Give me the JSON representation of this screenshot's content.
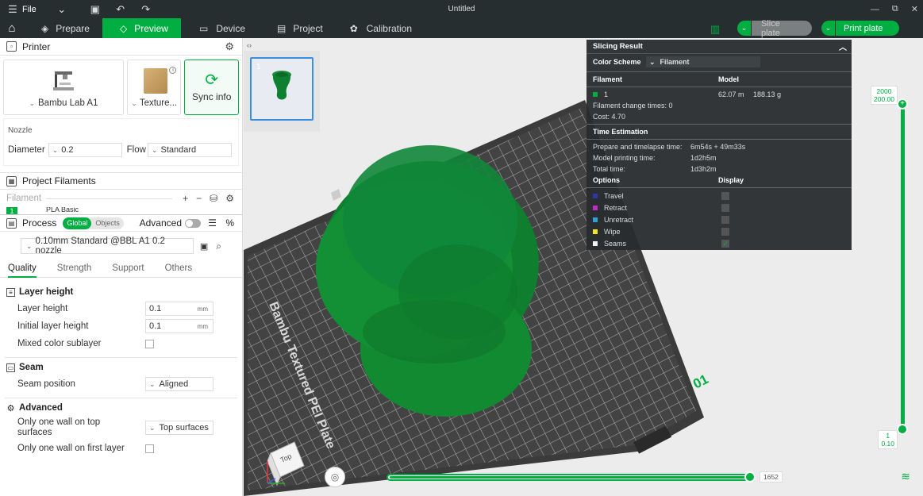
{
  "titlebar": {
    "file_label": "File",
    "title": "Untitled"
  },
  "tabs": [
    {
      "label": "Prepare",
      "icon": "cube-icon"
    },
    {
      "label": "Preview",
      "icon": "layers-icon",
      "active": true
    },
    {
      "label": "Device",
      "icon": "device-icon"
    },
    {
      "label": "Project",
      "icon": "project-icon"
    },
    {
      "label": "Calibration",
      "icon": "calibration-icon"
    }
  ],
  "actions": {
    "slice_label": "Slice plate",
    "print_label": "Print plate"
  },
  "printer": {
    "header": "Printer",
    "printer_name": "Bambu Lab A1",
    "plate_name": "Texture...",
    "sync_label": "Sync info",
    "nozzle_title": "Nozzle",
    "diameter_label": "Diameter",
    "diameter_value": "0.2",
    "flow_label": "Flow",
    "flow_value": "Standard"
  },
  "filaments": {
    "header": "Project Filaments",
    "filament_label": "Filament",
    "first_slot": "1",
    "first_name": "PLA Basic"
  },
  "process": {
    "header": "Process",
    "global_label": "Global",
    "objects_label": "Objects",
    "advanced_label": "Advanced",
    "preset": "0.10mm Standard @BBL A1 0.2 nozzle",
    "tabs": [
      "Quality",
      "Strength",
      "Support",
      "Others"
    ],
    "groups": {
      "layer_height": "Layer height",
      "seam": "Seam",
      "advanced": "Advanced"
    },
    "options": {
      "layer_height_label": "Layer height",
      "layer_height_value": "0.1",
      "initial_layer_height_label": "Initial layer height",
      "initial_layer_height_value": "0.1",
      "unit": "mm",
      "mixed_color_label": "Mixed color sublayer",
      "seam_position_label": "Seam position",
      "seam_position_value": "Aligned",
      "one_wall_top_label_1": "Only one wall on top",
      "one_wall_top_label_2": "surfaces",
      "one_wall_top_value": "Top surfaces",
      "one_wall_first_label": "Only one wall on first layer"
    }
  },
  "viewport": {
    "thumb_index": "1",
    "plate_text": "Bambu Textured PEI Plate",
    "plate_number": "01",
    "cube_label": "Top",
    "vslider_top_1": "2000",
    "vslider_top_2": "200.00",
    "vslider_bottom_1": "1",
    "vslider_bottom_2": "0.10",
    "hslider_value": "1652",
    "model_color": "#118a32"
  },
  "slicing_result": {
    "title": "Slicing Result",
    "color_scheme_label": "Color Scheme",
    "color_scheme_value": "Filament",
    "filament_col": "Filament",
    "model_col": "Model",
    "filament_index": "1",
    "filament_color": "#00ae42",
    "model_length": "62.07 m",
    "model_weight": "188.13 g",
    "change_times": "Filament change times:  0",
    "cost": "Cost:   4.70",
    "time_title": "Time Estimation",
    "prepare_label": "Prepare and timelapse time:",
    "prepare_value": "6m54s + 49m33s",
    "model_time_label": "Model printing time:",
    "model_time_value": "1d2h5m",
    "total_label": "Total time:",
    "total_value": "1d3h2m",
    "options_col": "Options",
    "display_col": "Display",
    "options": [
      {
        "label": "Travel",
        "color": "#2c3aa0"
      },
      {
        "label": "Retract",
        "color": "#c02cc8"
      },
      {
        "label": "Unretract",
        "color": "#2fa0d8"
      },
      {
        "label": "Wipe",
        "color": "#f0e81e"
      },
      {
        "label": "Seams",
        "color": "#f2f2f2"
      }
    ]
  }
}
